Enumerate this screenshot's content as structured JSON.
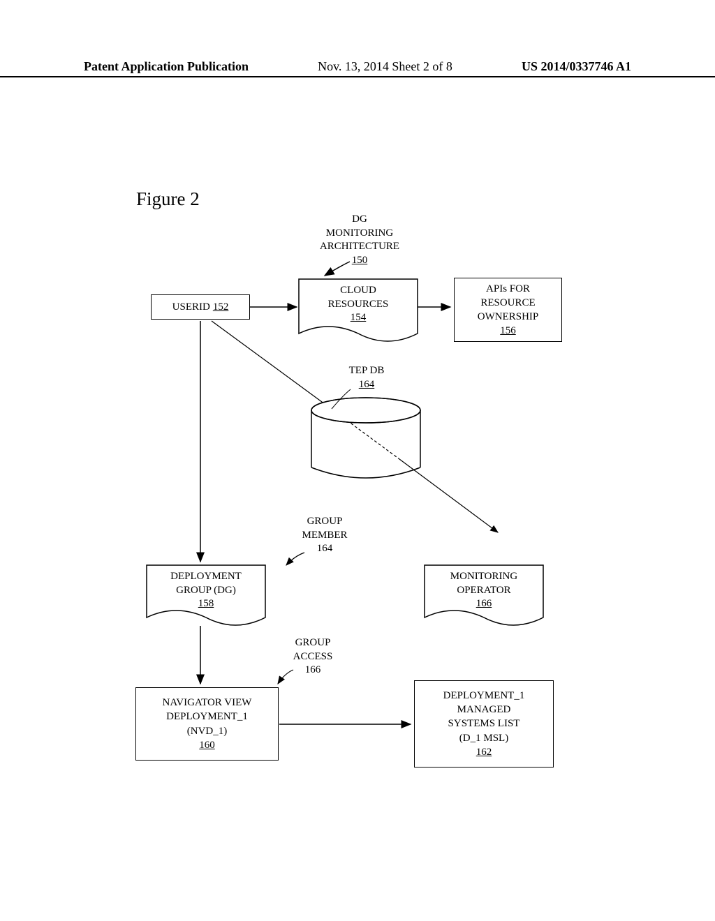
{
  "header": {
    "left": "Patent Application Publication",
    "center": "Nov. 13, 2014  Sheet 2 of 8",
    "right": "US 2014/0337746 A1"
  },
  "figure_title": "Figure 2",
  "diagram": {
    "title": {
      "line1": "DG",
      "line2": "MONITORING",
      "line3": "ARCHITECTURE",
      "ref": "150"
    },
    "userid": {
      "label": "USERID",
      "ref": "152"
    },
    "cloud_resources": {
      "line1": "CLOUD",
      "line2": "RESOURCES",
      "ref": "154"
    },
    "apis": {
      "line1": "APIs FOR",
      "line2": "RESOURCE",
      "line3": "OWNERSHIP",
      "ref": "156"
    },
    "tep_db": {
      "label": "TEP DB",
      "ref": "164"
    },
    "group_member": {
      "line1": "GROUP",
      "line2": "MEMBER",
      "ref": "164"
    },
    "deployment_group": {
      "line1": "DEPLOYMENT",
      "line2": "GROUP (DG)",
      "ref": "158"
    },
    "monitoring_operator": {
      "line1": "MONITORING",
      "line2": "OPERATOR",
      "ref": "166"
    },
    "group_access": {
      "line1": "GROUP",
      "line2": "ACCESS",
      "ref": "166"
    },
    "navigator_view": {
      "line1": "NAVIGATOR VIEW",
      "line2": "DEPLOYMENT_1",
      "line3": "(NVD_1)",
      "ref": "160"
    },
    "managed_systems": {
      "line1": "DEPLOYMENT_1",
      "line2": "MANAGED",
      "line3": "SYSTEMS LIST",
      "line4": "(D_1 MSL)",
      "ref": "162"
    }
  }
}
